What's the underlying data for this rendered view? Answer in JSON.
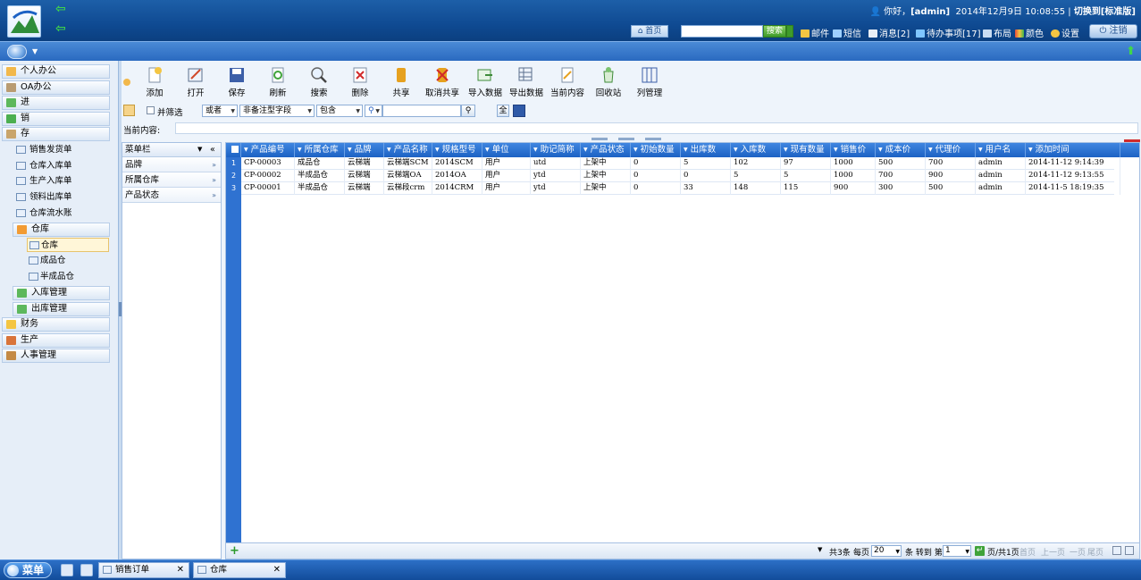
{
  "header": {
    "greeting_prefix": "你好，",
    "user": "[admin]",
    "datetime": "2014年12月9日  10:08:55",
    "switch_link": "切换到[标准版]",
    "home_label": "首页",
    "search_placeholder": "",
    "search_label": "搜索",
    "links": [
      "邮件",
      "短信",
      "消息[2]",
      "待办事项[17]",
      "布局",
      "颜色",
      "设置"
    ],
    "logout_label": "注销"
  },
  "sidebar": {
    "modules": [
      "个人办公",
      "OA办公",
      "进",
      "销",
      "存"
    ],
    "store_items": [
      "销售发货单",
      "仓库入库单",
      "生产入库单",
      "领料出库单",
      "仓库流水账"
    ],
    "warehouse_label": "仓库",
    "warehouse_items": [
      "仓库",
      "成品仓",
      "半成品仓"
    ],
    "store_tail": [
      "入库管理",
      "出库管理"
    ],
    "bottom_modules": [
      "财务",
      "生产",
      "人事管理"
    ]
  },
  "toolbar": {
    "buttons": [
      "添加",
      "打开",
      "保存",
      "刷新",
      "搜索",
      "删除",
      "共享",
      "取消共享",
      "导入数据",
      "导出数据",
      "当前内容",
      "回收站",
      "列管理"
    ]
  },
  "filter": {
    "and_filter_label": "并筛选",
    "logic": "或者",
    "field": "非备注型字段",
    "op": "包含",
    "value": "",
    "all_btn": "全",
    "current_label": "当前内容:"
  },
  "panel": {
    "title": "菜单栏",
    "collapse": "«",
    "items": [
      "品牌",
      "所属仓库",
      "产品状态"
    ]
  },
  "grid": {
    "columns": [
      "产品编号",
      "所属仓库",
      "品牌",
      "产品名称",
      "规格型号",
      "单位",
      "助记简称",
      "产品状态",
      "初始数量",
      "出库数",
      "入库数",
      "现有数量",
      "销售价",
      "成本价",
      "代理价",
      "用户名",
      "添加时间"
    ],
    "rows": [
      [
        "CP-00003",
        "成品仓",
        "云梯端",
        "云梯端SCM",
        "2014SCM",
        "用户",
        "utd",
        "上架中",
        "0",
        "5",
        "102",
        "97",
        "1000",
        "500",
        "700",
        "admin",
        "2014-11-12 9:14:39"
      ],
      [
        "CP-00002",
        "半成品仓",
        "云梯端",
        "云梯端OA",
        "2014OA",
        "用户",
        "ytd",
        "上架中",
        "0",
        "0",
        "5",
        "5",
        "1000",
        "700",
        "900",
        "admin",
        "2014-11-12 9:13:55"
      ],
      [
        "CP-00001",
        "半成品仓",
        "云梯端",
        "云梯段crm",
        "2014CRM",
        "用户",
        "ytd",
        "上架中",
        "0",
        "33",
        "148",
        "115",
        "900",
        "300",
        "500",
        "admin",
        "2014-11-5 18:19:35"
      ]
    ],
    "row_numbers": [
      "1",
      "2",
      "3"
    ]
  },
  "pager": {
    "total": "共3条",
    "per_page_label": "每页",
    "per_page": "20",
    "goto_label": "条 转到 第",
    "page": "1",
    "page_info": "页/共1页",
    "first": "首页",
    "prev": "上一页",
    "next": "一页",
    "last": "尾页"
  },
  "taskbar": {
    "start": "菜单",
    "tasks": [
      "销售订单",
      "仓库"
    ]
  }
}
